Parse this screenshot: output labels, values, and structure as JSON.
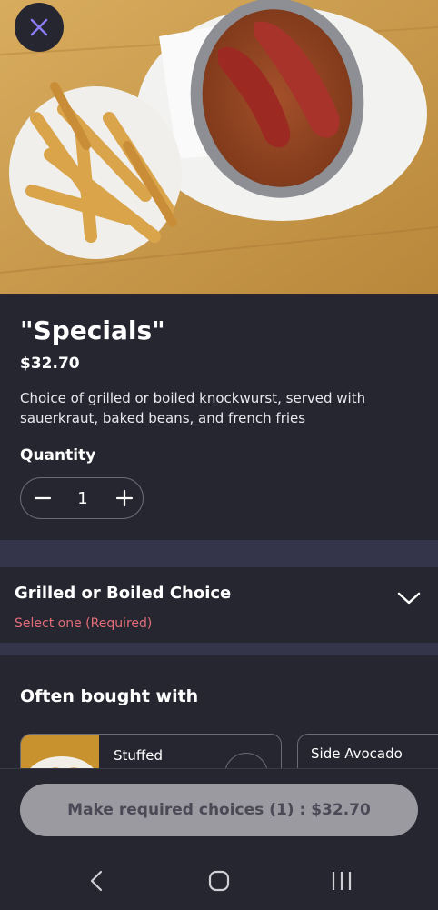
{
  "item": {
    "title": "\"Specials\"",
    "price": "$32.70",
    "description": "Choice of grilled or boiled knockwurst, served with sauerkraut, baked beans, and french fries"
  },
  "quantity": {
    "label": "Quantity",
    "value": "1"
  },
  "choice_group": {
    "title": "Grilled or Boiled Choice",
    "requirement": "Select one (Required)",
    "requirement_color": "#e26d77"
  },
  "often_bought": {
    "heading": "Often bought with",
    "items": [
      {
        "name": "Stuffed"
      },
      {
        "name": "Side Avocado"
      }
    ]
  },
  "cta": {
    "label": "Make required choices (1) : $32.70"
  },
  "colors": {
    "background": "#262631",
    "separator": "#34344a",
    "cta_bg": "#9b9aa0"
  },
  "icons": [
    "close-icon",
    "minus-icon",
    "plus-icon",
    "chevron-down-icon",
    "back-icon",
    "home-icon",
    "recents-icon"
  ]
}
